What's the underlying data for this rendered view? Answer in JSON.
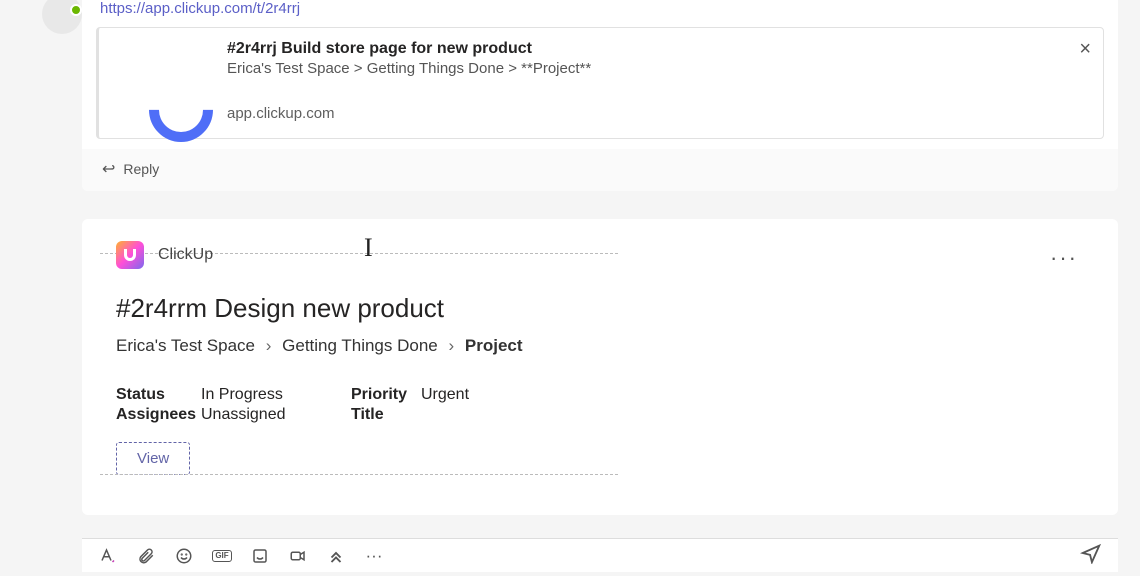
{
  "message1": {
    "url": "https://app.clickup.com/t/2r4rrj",
    "preview": {
      "title": "#2r4rrj Build store page for new product",
      "path": "Erica's Test Space > Getting Things Done > **Project**",
      "domain": "app.clickup.com"
    },
    "reply_label": "Reply"
  },
  "card": {
    "app_name": "ClickUp",
    "title": "#2r4rrm Design new product",
    "breadcrumb": [
      "Erica's Test Space",
      "Getting Things Done",
      "Project"
    ],
    "meta": {
      "status_label": "Status",
      "status_value": "In Progress",
      "assignees_label": "Assignees",
      "assignees_value": "Unassigned",
      "priority_label": "Priority",
      "priority_value": "Urgent",
      "title_label": "Title",
      "title_value": ""
    },
    "view_label": "View",
    "more_label": "···"
  },
  "toolbar": {
    "gif_label": "GIF",
    "more_label": "···"
  }
}
